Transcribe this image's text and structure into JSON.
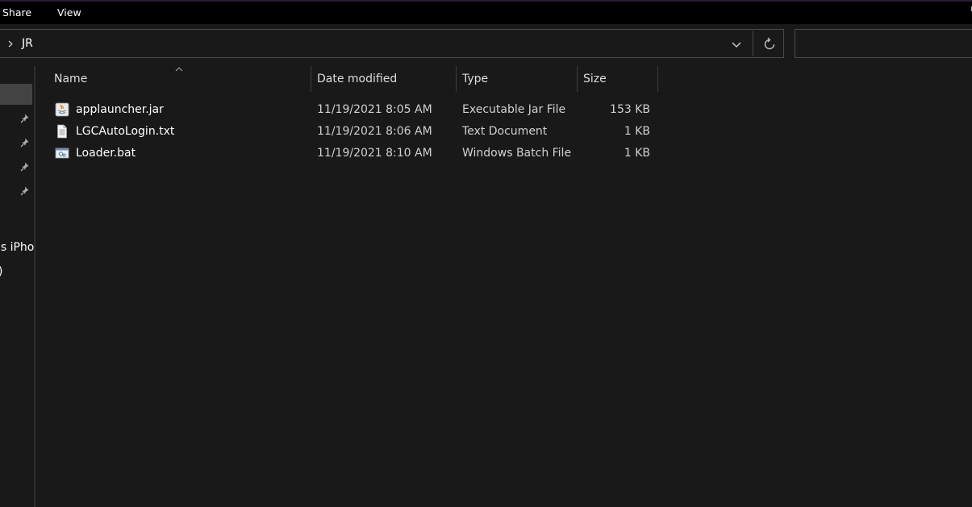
{
  "ribbon": {
    "tabs": [
      "Share",
      "View"
    ]
  },
  "address_bar": {
    "path": "JR"
  },
  "search": {
    "placeholder": ""
  },
  "nav_pane": {
    "partial_labels": [
      "'s iPho",
      ")"
    ]
  },
  "file_list": {
    "columns": [
      "Name",
      "Date modified",
      "Type",
      "Size"
    ],
    "sort_column": "Name",
    "rows": [
      {
        "name": "applauncher.jar",
        "date": "11/19/2021 8:05 AM",
        "type": "Executable Jar File",
        "size": "153 KB",
        "icon": "java-jar-icon"
      },
      {
        "name": "LGCAutoLogin.txt",
        "date": "11/19/2021 8:06 AM",
        "type": "Text Document",
        "size": "1 KB",
        "icon": "text-document-icon"
      },
      {
        "name": "Loader.bat",
        "date": "11/19/2021 8:10 AM",
        "type": "Windows Batch File",
        "size": "1 KB",
        "icon": "batch-file-icon"
      }
    ]
  },
  "colors": {
    "background": "#191919",
    "ribbon": "#000000",
    "border": "#4a4a4a",
    "nav_selected": "#434343"
  }
}
